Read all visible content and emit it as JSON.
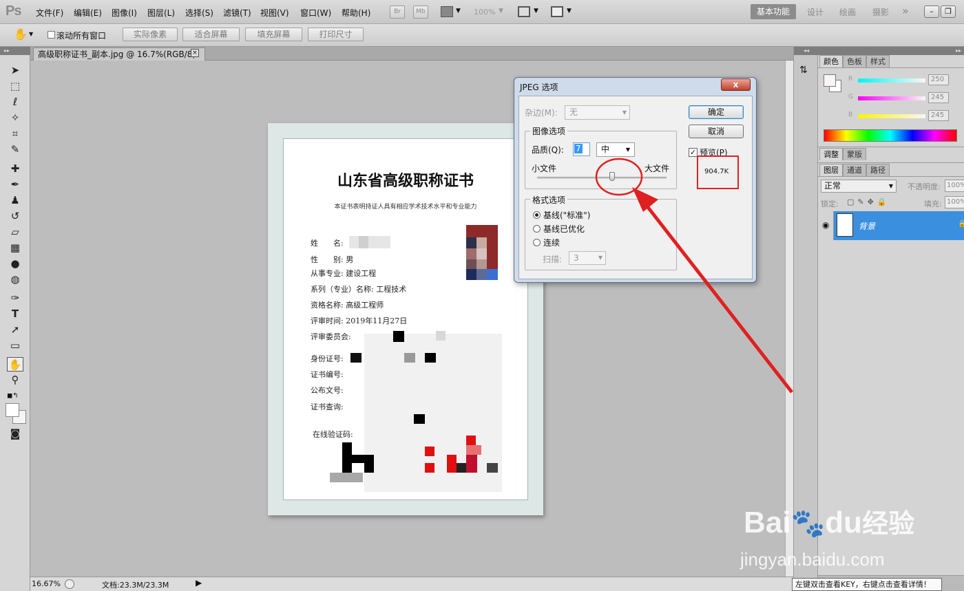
{
  "app": {
    "logo": "Ps"
  },
  "menu": {
    "items": [
      "文件(F)",
      "编辑(E)",
      "图像(I)",
      "图层(L)",
      "选择(S)",
      "滤镜(T)",
      "视图(V)",
      "窗口(W)",
      "帮助(H)"
    ]
  },
  "toolbar": {
    "br": "Br",
    "mb": "Mb",
    "zoom": "100%"
  },
  "workspaces": {
    "active": "基本功能",
    "others": [
      "设计",
      "绘画",
      "摄影"
    ],
    "more": "»"
  },
  "options": {
    "scroll_all": "滚动所有窗口",
    "buttons": [
      "实际像素",
      "适合屏幕",
      "填充屏幕",
      "打印尺寸"
    ]
  },
  "document": {
    "tab_title": "高级职称证书_副本.jpg @ 16.7%(RGB/8)",
    "close": "×"
  },
  "status": {
    "zoom": "16.67%",
    "doc_info": "文档:23.3M/23.3M"
  },
  "certificate": {
    "title": "山东省高级职称证书",
    "subtitle": "本证书表明持证人具有相应学术技术水平和专业能力",
    "lines": [
      "姓　　名:",
      "性　　别: 男",
      "从事专业: 建设工程",
      "系列（专业）名称: 工程技术",
      "资格名称: 高级工程师",
      "评审时间: 2019年11月27日",
      "评审委员会:",
      "身份证号:",
      "证书编号:",
      "公布文号:",
      "证书查询:",
      "在线验证码:"
    ]
  },
  "dialog": {
    "title": "JPEG 选项",
    "close": "x",
    "matte_label": "杂边(M):",
    "matte_value": "无",
    "image_options_title": "图像选项",
    "quality_label": "品质(Q):",
    "quality_value": "7",
    "quality_preset": "中",
    "small_file": "小文件",
    "large_file": "大文件",
    "quality_fraction": 0.58,
    "format_options_title": "格式选项",
    "formats": [
      "基线(\"标准\")",
      "基线已优化",
      "连续"
    ],
    "selected_format": 0,
    "scans_label": "扫描:",
    "scans_value": "3",
    "ok": "确定",
    "cancel": "取消",
    "preview_label": "预览(P)",
    "preview_checked": true,
    "file_size": "904.7K"
  },
  "color_panel": {
    "tabs": [
      "颜色",
      "色板",
      "样式"
    ],
    "channels": [
      {
        "label": "R",
        "value": "250"
      },
      {
        "label": "G",
        "value": "245"
      },
      {
        "label": "B",
        "value": "245"
      }
    ]
  },
  "adjust_tabs": [
    "调整",
    "蒙版"
  ],
  "layers_panel": {
    "tabs": [
      "图层",
      "通道",
      "路径"
    ],
    "blend_mode": "正常",
    "opacity_label": "不透明度:",
    "opacity": "100%",
    "lock_label": "锁定:",
    "fill_label": "填充:",
    "fill": "100%",
    "layer_name": "背景"
  },
  "tooltip": "左键双击查看KEY，右键点击查看详情！",
  "watermark": {
    "brand": "Bai",
    "du": "du",
    "jingyan": "经验",
    "url": "jingyan.baidu.com"
  },
  "colors": {
    "accent_red": "#e02020",
    "layer_selected": "#3a8fdf"
  }
}
